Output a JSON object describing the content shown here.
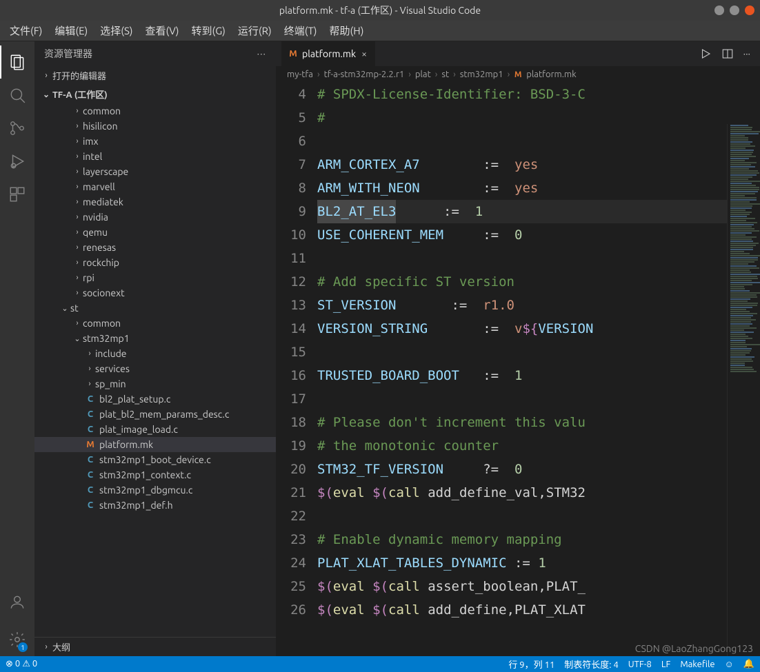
{
  "window": {
    "title": "platform.mk - tf-a (工作区) - Visual Studio Code"
  },
  "menu": [
    "文件(F)",
    "编辑(E)",
    "选择(S)",
    "查看(V)",
    "转到(G)",
    "运行(R)",
    "终端(T)",
    "帮助(H)"
  ],
  "sidebar": {
    "title": "资源管理器",
    "open_editors": "打开的编辑器",
    "workspace": "TF-A (工作区)",
    "tree": [
      {
        "label": "common",
        "indent": 2,
        "type": "folder",
        "twisty": "›"
      },
      {
        "label": "hisilicon",
        "indent": 2,
        "type": "folder",
        "twisty": "›"
      },
      {
        "label": "imx",
        "indent": 2,
        "type": "folder",
        "twisty": "›"
      },
      {
        "label": "intel",
        "indent": 2,
        "type": "folder",
        "twisty": "›"
      },
      {
        "label": "layerscape",
        "indent": 2,
        "type": "folder",
        "twisty": "›"
      },
      {
        "label": "marvell",
        "indent": 2,
        "type": "folder",
        "twisty": "›"
      },
      {
        "label": "mediatek",
        "indent": 2,
        "type": "folder",
        "twisty": "›"
      },
      {
        "label": "nvidia",
        "indent": 2,
        "type": "folder",
        "twisty": "›"
      },
      {
        "label": "qemu",
        "indent": 2,
        "type": "folder",
        "twisty": "›"
      },
      {
        "label": "renesas",
        "indent": 2,
        "type": "folder",
        "twisty": "›"
      },
      {
        "label": "rockchip",
        "indent": 2,
        "type": "folder",
        "twisty": "›"
      },
      {
        "label": "rpi",
        "indent": 2,
        "type": "folder",
        "twisty": "›"
      },
      {
        "label": "socionext",
        "indent": 2,
        "type": "folder",
        "twisty": "›"
      },
      {
        "label": "st",
        "indent": 1,
        "type": "folder",
        "twisty": "⌄"
      },
      {
        "label": "common",
        "indent": 2,
        "type": "folder",
        "twisty": "›"
      },
      {
        "label": "stm32mp1",
        "indent": 2,
        "type": "folder",
        "twisty": "⌄"
      },
      {
        "label": "include",
        "indent": 3,
        "type": "folder",
        "twisty": "›"
      },
      {
        "label": "services",
        "indent": 3,
        "type": "folder",
        "twisty": "›"
      },
      {
        "label": "sp_min",
        "indent": 3,
        "type": "folder",
        "twisty": "›"
      },
      {
        "label": "bl2_plat_setup.c",
        "indent": 3,
        "type": "c"
      },
      {
        "label": "plat_bl2_mem_params_desc.c",
        "indent": 3,
        "type": "c"
      },
      {
        "label": "plat_image_load.c",
        "indent": 3,
        "type": "c"
      },
      {
        "label": "platform.mk",
        "indent": 3,
        "type": "mk",
        "selected": true
      },
      {
        "label": "stm32mp1_boot_device.c",
        "indent": 3,
        "type": "c"
      },
      {
        "label": "stm32mp1_context.c",
        "indent": 3,
        "type": "c"
      },
      {
        "label": "stm32mp1_dbgmcu.c",
        "indent": 3,
        "type": "c"
      },
      {
        "label": "stm32mp1_def.h",
        "indent": 3,
        "type": "c"
      }
    ],
    "outline": "大纲"
  },
  "tab": {
    "label": "platform.mk"
  },
  "breadcrumbs": [
    "my-tfa",
    "tf-a-stm32mp-2.2.r1",
    "plat",
    "st",
    "stm32mp1",
    "platform.mk"
  ],
  "code": {
    "start": 4,
    "lines": [
      [
        [
          "comm",
          "# SPDX-License-Identifier: BSD-3-C"
        ]
      ],
      [
        [
          "comm",
          "#"
        ]
      ],
      [],
      [
        [
          "var",
          "ARM_CORTEX_A7"
        ],
        [
          "op",
          "        :=  "
        ],
        [
          "str",
          "yes"
        ]
      ],
      [
        [
          "var",
          "ARM_WITH_NEON"
        ],
        [
          "op",
          "        :=  "
        ],
        [
          "str",
          "yes"
        ]
      ],
      [
        [
          "var",
          "BL2_AT_EL3",
          "sel"
        ],
        [
          "op",
          "      :=  "
        ],
        [
          "num",
          "1"
        ]
      ],
      [
        [
          "var",
          "USE_COHERENT_MEM"
        ],
        [
          "op",
          "     :=  "
        ],
        [
          "num",
          "0"
        ]
      ],
      [],
      [
        [
          "comm",
          "# Add specific ST version"
        ]
      ],
      [
        [
          "var",
          "ST_VERSION"
        ],
        [
          "op",
          "       :=  "
        ],
        [
          "str",
          "r1.0"
        ]
      ],
      [
        [
          "var",
          "VERSION_STRING"
        ],
        [
          "op",
          "       :=  "
        ],
        [
          "str",
          "v"
        ],
        [
          "kw",
          "${"
        ],
        [
          "var",
          "VERSION"
        ]
      ],
      [],
      [
        [
          "var",
          "TRUSTED_BOARD_BOOT"
        ],
        [
          "op",
          "   :=  "
        ],
        [
          "num",
          "1"
        ]
      ],
      [],
      [
        [
          "comm",
          "# Please don't increment this valu"
        ]
      ],
      [
        [
          "comm",
          "# the monotonic counter"
        ]
      ],
      [
        [
          "var",
          "STM32_TF_VERSION"
        ],
        [
          "op",
          "     ?=  "
        ],
        [
          "num",
          "0"
        ]
      ],
      [
        [
          "kw",
          "$("
        ],
        [
          "fn",
          "eval"
        ],
        [
          "op",
          " "
        ],
        [
          "kw",
          "$("
        ],
        [
          "fn",
          "call"
        ],
        [
          "op",
          " add_define_val,STM32"
        ]
      ],
      [],
      [
        [
          "comm",
          "# Enable dynamic memory mapping"
        ]
      ],
      [
        [
          "var",
          "PLAT_XLAT_TABLES_DYNAMIC"
        ],
        [
          "op",
          " := "
        ],
        [
          "num",
          "1"
        ]
      ],
      [
        [
          "kw",
          "$("
        ],
        [
          "fn",
          "eval"
        ],
        [
          "op",
          " "
        ],
        [
          "kw",
          "$("
        ],
        [
          "fn",
          "call"
        ],
        [
          "op",
          " assert_boolean,PLAT_"
        ]
      ],
      [
        [
          "kw",
          "$("
        ],
        [
          "fn",
          "eval"
        ],
        [
          "op",
          " "
        ],
        [
          "kw",
          "$("
        ],
        [
          "fn",
          "call"
        ],
        [
          "op",
          " add_define,PLAT_XLAT"
        ]
      ]
    ]
  },
  "status": {
    "errors": "0",
    "warnings": "0",
    "cursor": "行 9，列 11",
    "spaces": "制表符长度: 4",
    "encoding": "UTF-8",
    "eol": "LF",
    "lang": "Makefile",
    "feedback": "☺"
  },
  "watermark": "CSDN @LaoZhangGong123",
  "settings_badge": "1"
}
